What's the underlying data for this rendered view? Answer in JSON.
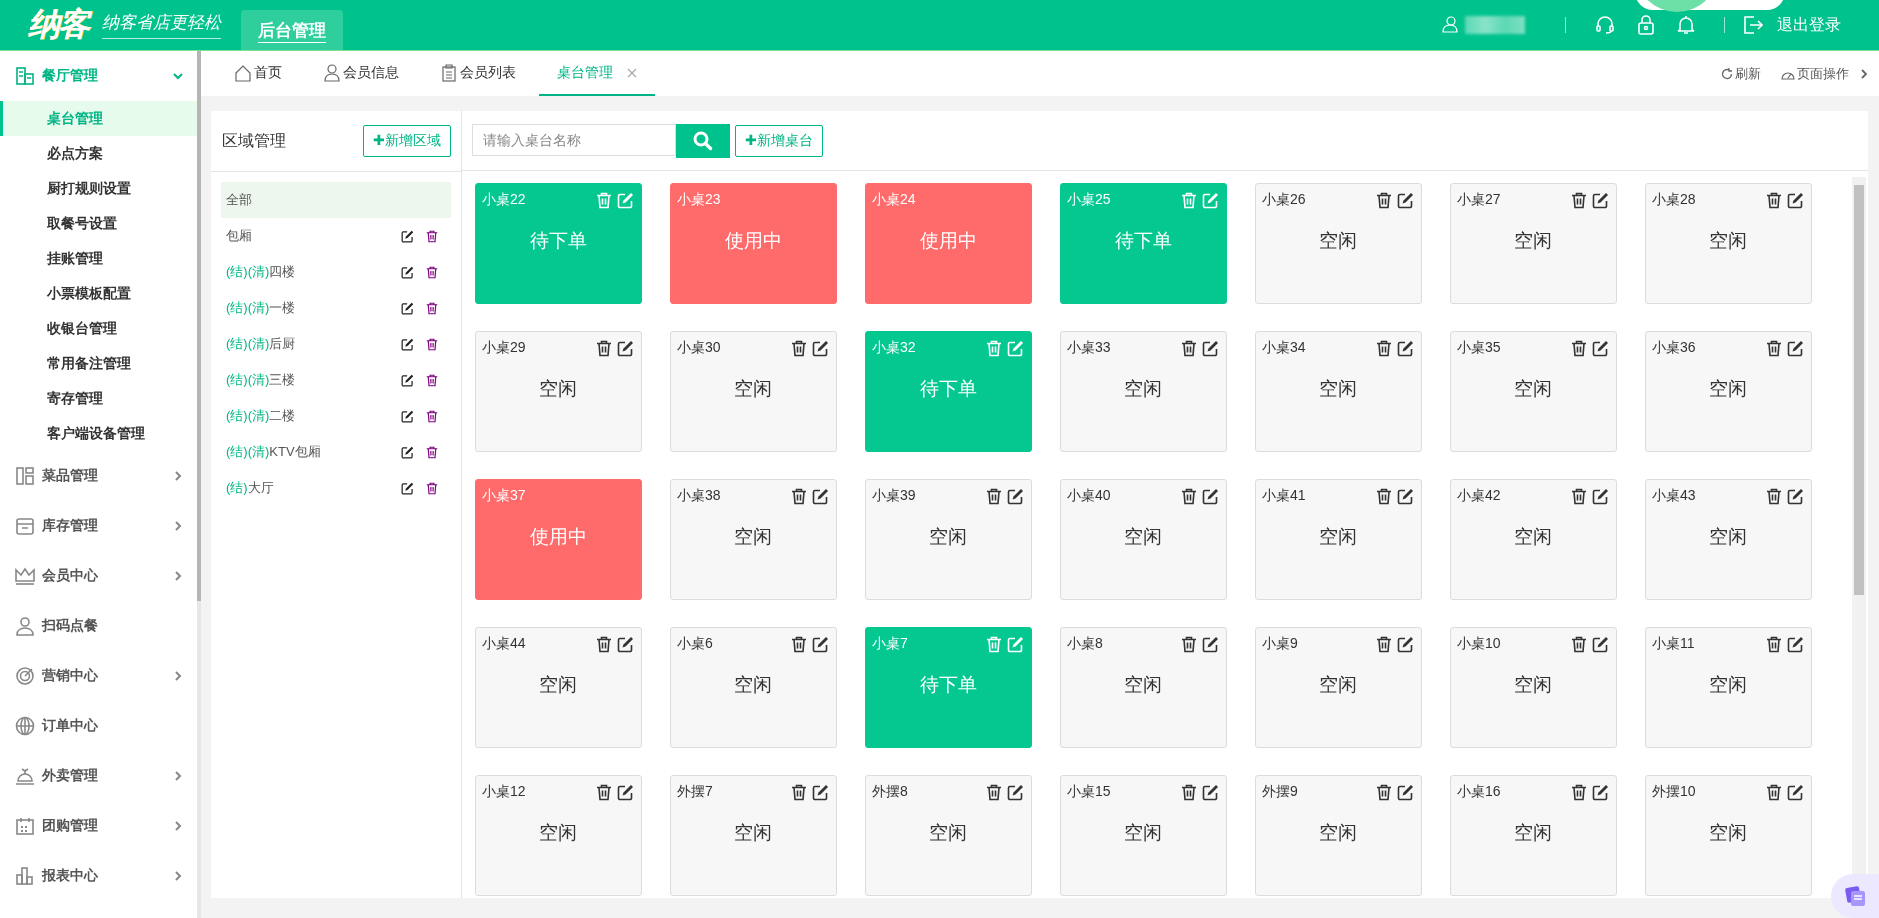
{
  "topbar": {
    "logo": "纳客",
    "slogan": "纳客省店更轻松",
    "tabs": [
      {
        "label": "后台管理",
        "selected": true
      }
    ],
    "logout": "退出登录"
  },
  "sidebar": {
    "sections": [
      {
        "label": "餐厅管理",
        "expanded": true,
        "has_children": true,
        "children": [
          {
            "label": "桌台管理",
            "selected": true
          },
          {
            "label": "必点方案",
            "selected": false
          },
          {
            "label": "厨打规则设置",
            "selected": false
          },
          {
            "label": "取餐号设置",
            "selected": false
          },
          {
            "label": "挂账管理",
            "selected": false
          },
          {
            "label": "小票模板配置",
            "selected": false
          },
          {
            "label": "收银台管理",
            "selected": false
          },
          {
            "label": "常用备注管理",
            "selected": false
          },
          {
            "label": "寄存管理",
            "selected": false
          },
          {
            "label": "客户端设备管理",
            "selected": false
          }
        ]
      },
      {
        "label": "菜品管理",
        "expanded": false,
        "has_children": true
      },
      {
        "label": "库存管理",
        "expanded": false,
        "has_children": true
      },
      {
        "label": "会员中心",
        "expanded": false,
        "has_children": true
      },
      {
        "label": "扫码点餐",
        "expanded": false,
        "has_children": false
      },
      {
        "label": "营销中心",
        "expanded": false,
        "has_children": true
      },
      {
        "label": "订单中心",
        "expanded": false,
        "has_children": false
      },
      {
        "label": "外卖管理",
        "expanded": false,
        "has_children": true
      },
      {
        "label": "团购管理",
        "expanded": false,
        "has_children": true
      },
      {
        "label": "报表中心",
        "expanded": false,
        "has_children": true
      }
    ]
  },
  "page_tabs": {
    "tabs": [
      {
        "label": "首页",
        "selected": false,
        "closable": false
      },
      {
        "label": "会员信息",
        "selected": false,
        "closable": false
      },
      {
        "label": "会员列表",
        "selected": false,
        "closable": false
      },
      {
        "label": "桌台管理",
        "selected": true,
        "closable": true
      }
    ],
    "refresh": "刷新",
    "page_actions": "页面操作"
  },
  "area_panel": {
    "title": "区域管理",
    "add_button": "✚新增区域",
    "areas": [
      {
        "name": "全部",
        "selected": true,
        "editable": false
      },
      {
        "name": "包厢",
        "selected": false,
        "editable": true
      },
      {
        "tags": "(结)(清)",
        "name": "四楼",
        "selected": false,
        "editable": true
      },
      {
        "tags": "(结)(清)",
        "name": "一楼",
        "selected": false,
        "editable": true
      },
      {
        "tags": "(结)(清)",
        "name": "后厨",
        "selected": false,
        "editable": true
      },
      {
        "tags": "(结)(清)",
        "name": "三楼",
        "selected": false,
        "editable": true
      },
      {
        "tags": "(结)(清)",
        "name": "二楼",
        "selected": false,
        "editable": true
      },
      {
        "tags": "(结)(清)",
        "name": "KTV包厢",
        "selected": false,
        "editable": true
      },
      {
        "tags": "(结)",
        "name": "大厅",
        "selected": false,
        "editable": true
      }
    ]
  },
  "table_panel": {
    "search": {
      "placeholder": "请输入桌台名称"
    },
    "add_button": "✚新增桌台",
    "tables": [
      {
        "name": "小桌22",
        "status": "待下单",
        "kind": "pending"
      },
      {
        "name": "小桌23",
        "status": "使用中",
        "kind": "in_use"
      },
      {
        "name": "小桌24",
        "status": "使用中",
        "kind": "in_use"
      },
      {
        "name": "小桌25",
        "status": "待下单",
        "kind": "pending"
      },
      {
        "name": "小桌26",
        "status": "空闲",
        "kind": "idle"
      },
      {
        "name": "小桌27",
        "status": "空闲",
        "kind": "idle"
      },
      {
        "name": "小桌28",
        "status": "空闲",
        "kind": "idle"
      },
      {
        "name": "小桌29",
        "status": "空闲",
        "kind": "idle"
      },
      {
        "name": "小桌30",
        "status": "空闲",
        "kind": "idle"
      },
      {
        "name": "小桌32",
        "status": "待下单",
        "kind": "pending"
      },
      {
        "name": "小桌33",
        "status": "空闲",
        "kind": "idle"
      },
      {
        "name": "小桌34",
        "status": "空闲",
        "kind": "idle"
      },
      {
        "name": "小桌35",
        "status": "空闲",
        "kind": "idle"
      },
      {
        "name": "小桌36",
        "status": "空闲",
        "kind": "idle"
      },
      {
        "name": "小桌37",
        "status": "使用中",
        "kind": "in_use"
      },
      {
        "name": "小桌38",
        "status": "空闲",
        "kind": "idle"
      },
      {
        "name": "小桌39",
        "status": "空闲",
        "kind": "idle"
      },
      {
        "name": "小桌40",
        "status": "空闲",
        "kind": "idle"
      },
      {
        "name": "小桌41",
        "status": "空闲",
        "kind": "idle"
      },
      {
        "name": "小桌42",
        "status": "空闲",
        "kind": "idle"
      },
      {
        "name": "小桌43",
        "status": "空闲",
        "kind": "idle"
      },
      {
        "name": "小桌44",
        "status": "空闲",
        "kind": "idle"
      },
      {
        "name": "小桌6",
        "status": "空闲",
        "kind": "idle"
      },
      {
        "name": "小桌7",
        "status": "待下单",
        "kind": "pending"
      },
      {
        "name": "小桌8",
        "status": "空闲",
        "kind": "idle"
      },
      {
        "name": "小桌9",
        "status": "空闲",
        "kind": "idle"
      },
      {
        "name": "小桌10",
        "status": "空闲",
        "kind": "idle"
      },
      {
        "name": "小桌11",
        "status": "空闲",
        "kind": "idle"
      },
      {
        "name": "小桌12",
        "status": "空闲",
        "kind": "idle"
      },
      {
        "name": "外摆7",
        "status": "空闲",
        "kind": "idle"
      },
      {
        "name": "外摆8",
        "status": "空闲",
        "kind": "idle"
      },
      {
        "name": "小桌15",
        "status": "空闲",
        "kind": "idle"
      },
      {
        "name": "外摆9",
        "status": "空闲",
        "kind": "idle"
      },
      {
        "name": "小桌16",
        "status": "空闲",
        "kind": "idle"
      },
      {
        "name": "外摆10",
        "status": "空闲",
        "kind": "idle"
      }
    ]
  }
}
